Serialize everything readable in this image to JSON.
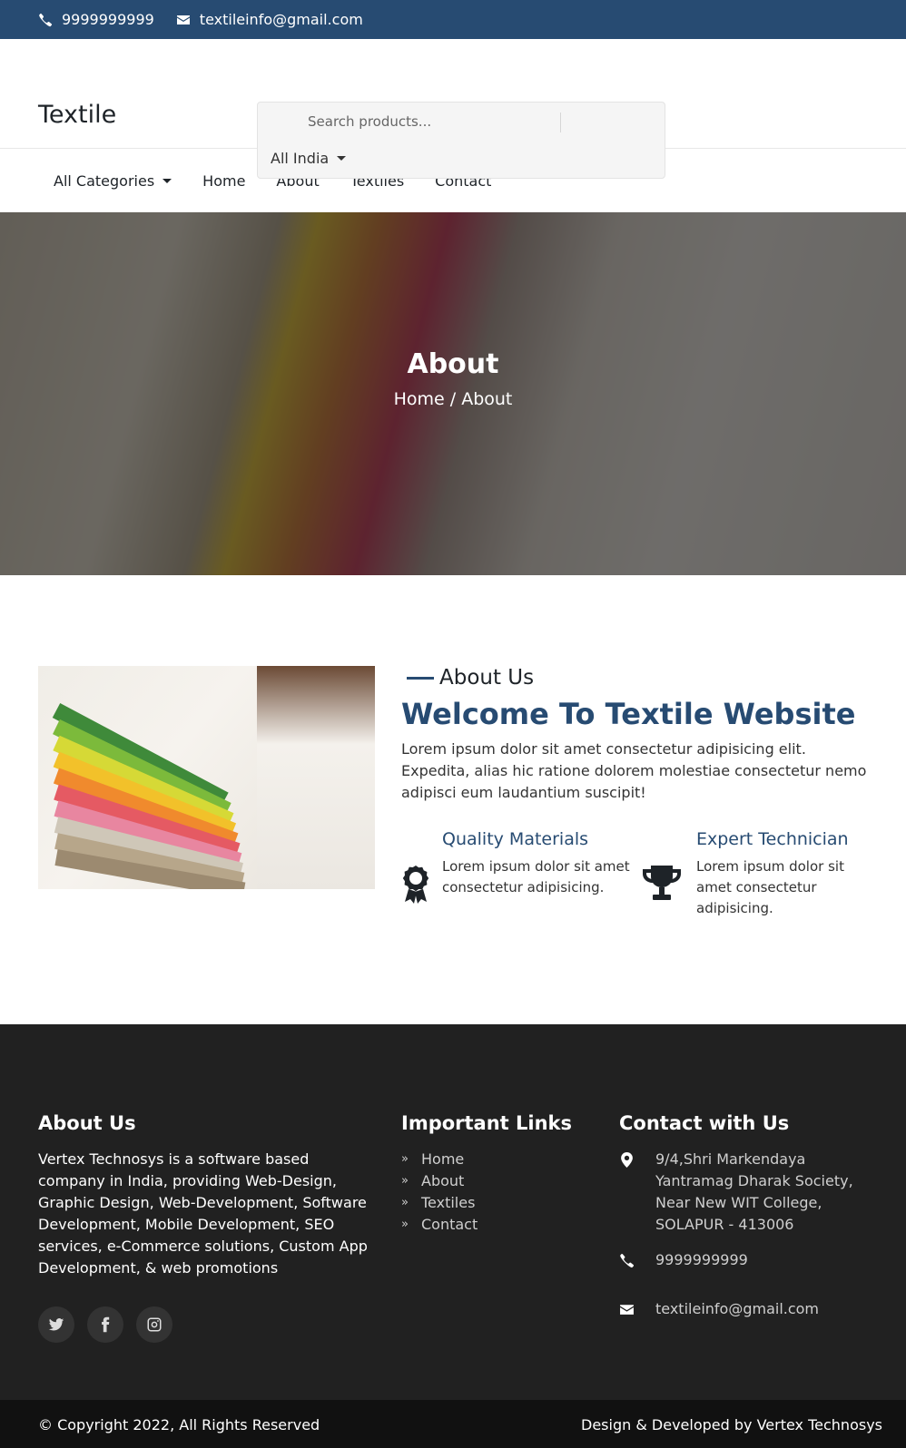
{
  "topbar": {
    "phone": "9999999999",
    "email": "textileinfo@gmail.com"
  },
  "header": {
    "brand": "Textile",
    "search_placeholder": "Search products...",
    "region": "All India"
  },
  "nav": {
    "categories": "All Categories",
    "items": [
      "Home",
      "About",
      "Textiles",
      "Contact"
    ]
  },
  "hero": {
    "title": "About",
    "breadcrumb": "Home / About"
  },
  "about": {
    "eyebrow": "About Us",
    "title": "Welcome To Textile Website",
    "lead": "Lorem ipsum dolor sit amet consectetur adipisicing elit. Expedita, alias hic ratione dolorem molestiae consectetur nemo adipisci eum laudantium suscipit!",
    "features": [
      {
        "title": "Quality Materials",
        "desc": "Lorem ipsum dolor sit amet consectetur adipisicing.",
        "icon": "award-icon"
      },
      {
        "title": "Expert Technician",
        "desc": "Lorem ipsum dolor sit amet consectetur adipisicing.",
        "icon": "trophy-icon"
      }
    ]
  },
  "footer": {
    "about": {
      "heading": "About Us",
      "text": "Vertex Technosys is a software based company in India, providing Web-Design, Graphic Design, Web-Development, Software Development, Mobile Development, SEO services, e-Commerce solutions, Custom App Development, & web promotions"
    },
    "social": [
      "twitter-icon",
      "facebook-icon",
      "instagram-icon"
    ],
    "links": {
      "heading": "Important Links",
      "items": [
        "Home",
        "About",
        "Textiles",
        "Contact"
      ]
    },
    "contact": {
      "heading": "Contact with Us",
      "address": "9/4,Shri Markendaya Yantramag Dharak Society, Near New WIT College, SOLAPUR - 413006",
      "phone": "9999999999",
      "email": "textileinfo@gmail.com"
    },
    "copyright": "© Copyright 2022, All Rights Reserved",
    "credit": "Design & Developed by Vertex Technosys"
  }
}
